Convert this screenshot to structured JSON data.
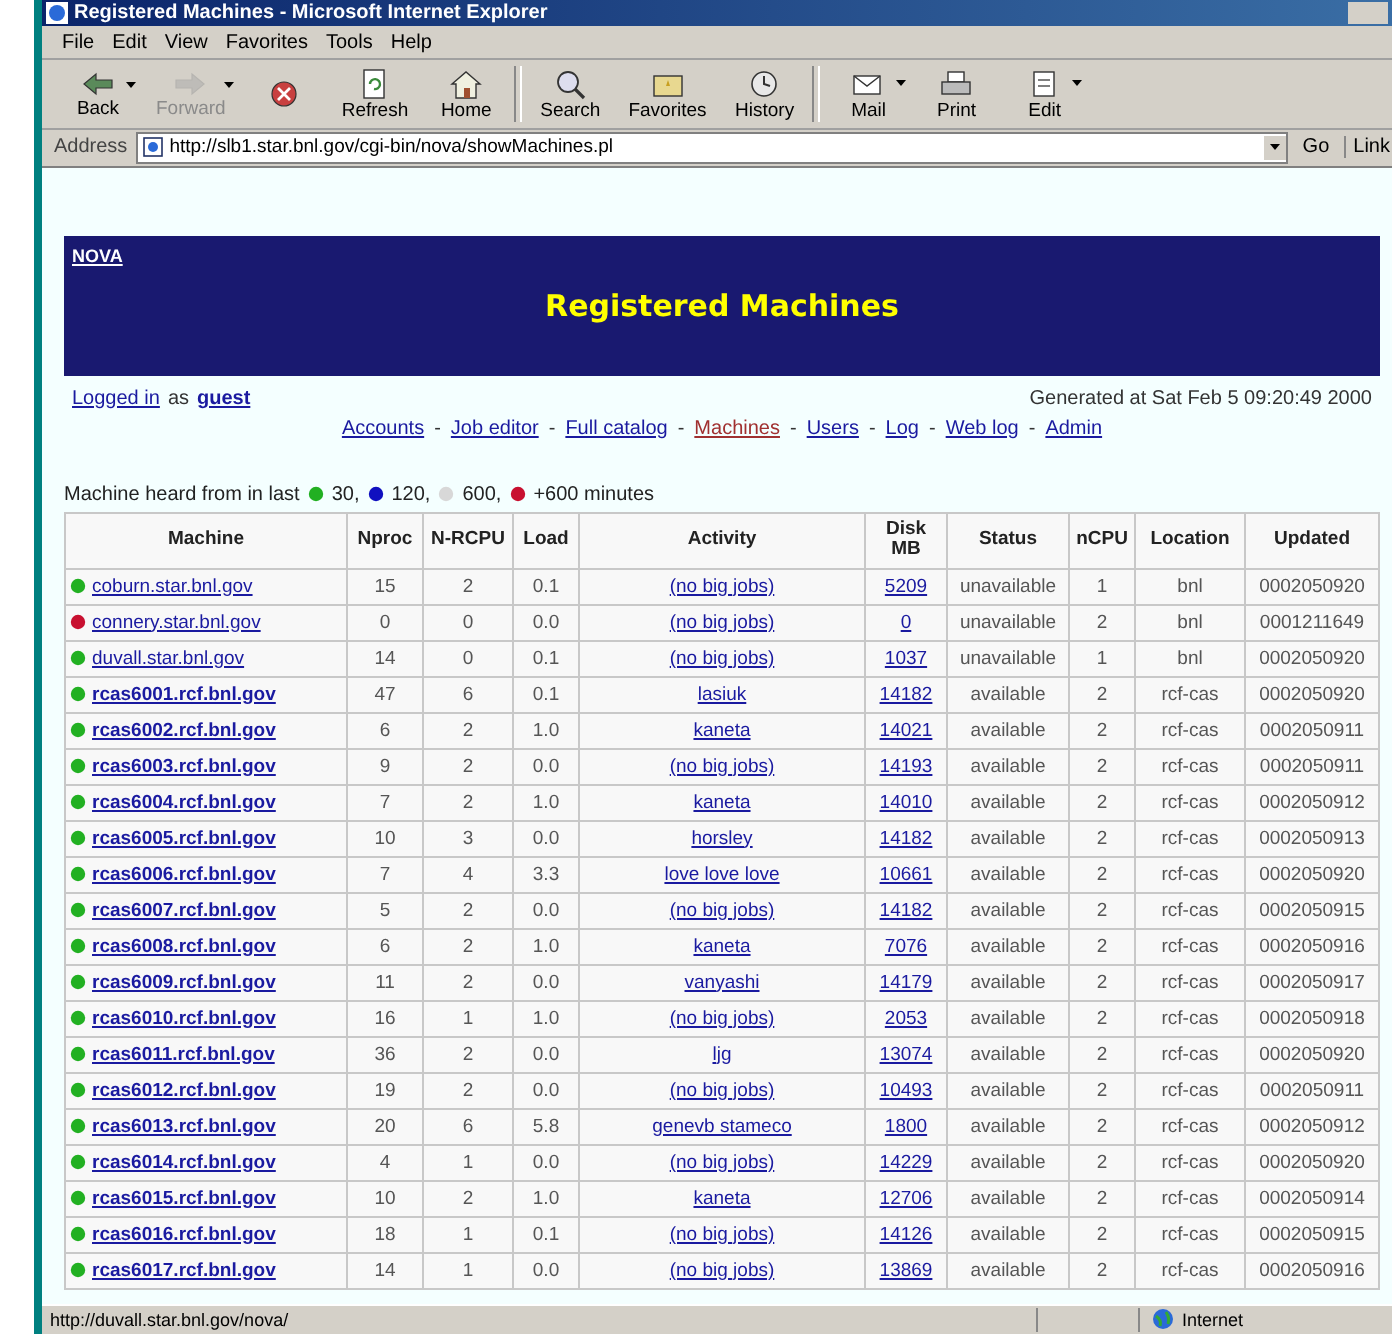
{
  "window": {
    "title": "Registered Machines - Microsoft Internet Explorer"
  },
  "menu": [
    "File",
    "Edit",
    "View",
    "Favorites",
    "Tools",
    "Help"
  ],
  "toolbar": {
    "buttons": [
      {
        "label": "Back",
        "kind": "back",
        "disabled": false,
        "has_menu": true,
        "divider_before": false
      },
      {
        "label": "Forward",
        "kind": "forward",
        "disabled": true,
        "has_menu": true,
        "divider_before": false
      },
      {
        "kind": "stop",
        "disabled": false,
        "has_menu": false,
        "divider_before": false
      },
      {
        "label": "Refresh",
        "kind": "refresh",
        "disabled": false,
        "has_menu": false,
        "divider_before": false
      },
      {
        "label": "Home",
        "kind": "home",
        "disabled": false,
        "has_menu": false,
        "divider_before": false
      },
      {
        "label": "Search",
        "kind": "search",
        "disabled": false,
        "has_menu": false,
        "divider_before": true
      },
      {
        "label": "Favorites",
        "kind": "favorites",
        "disabled": false,
        "has_menu": false,
        "divider_before": false
      },
      {
        "label": "History",
        "kind": "history",
        "disabled": false,
        "has_menu": false,
        "divider_before": false
      },
      {
        "label": "Mail",
        "kind": "mail",
        "disabled": false,
        "has_menu": true,
        "divider_before": true
      },
      {
        "label": "Print",
        "kind": "print",
        "disabled": false,
        "has_menu": false,
        "divider_before": false
      },
      {
        "label": "Edit",
        "kind": "edit",
        "disabled": false,
        "has_menu": true,
        "divider_before": false
      }
    ]
  },
  "address": {
    "label": "Address",
    "value": "http://slb1.star.bnl.gov/cgi-bin/nova/showMachines.pl",
    "go": "Go",
    "links": "Link"
  },
  "banner": {
    "home_link": "NOVA",
    "title": "Registered Machines"
  },
  "session": {
    "prefix": "Logged in",
    "middle": "as",
    "user": "guest",
    "generated": "Generated at Sat Feb 5 09:20:49 2000"
  },
  "nav": {
    "links": [
      {
        "label": "Accounts",
        "selected": false
      },
      {
        "label": "Job editor",
        "selected": false
      },
      {
        "label": "Full catalog",
        "selected": false
      },
      {
        "label": "Machines",
        "selected": true
      },
      {
        "label": "Users",
        "selected": false
      },
      {
        "label": "Log",
        "selected": false
      },
      {
        "label": "Web log",
        "selected": false
      },
      {
        "label": "Admin",
        "selected": false
      }
    ],
    "separator": "-"
  },
  "legend": {
    "text": "Machine heard from in last",
    "items": [
      {
        "label": "30,",
        "color": "#22b022"
      },
      {
        "label": "120,",
        "color": "#1010c0"
      },
      {
        "label": "600,",
        "color": "#d8d8d8"
      },
      {
        "label": "+600 minutes",
        "color": "#c81030"
      }
    ]
  },
  "table": {
    "columns": [
      "Machine",
      "Nproc",
      "N-RCPU",
      "Load",
      "Activity",
      "Disk MB",
      "Status",
      "nCPU",
      "Location",
      "Updated"
    ],
    "rows": [
      {
        "machine": "coburn.star.bnl.gov",
        "color": "#22b022",
        "emphasized": false,
        "nproc": "15",
        "nrcpu": "2",
        "load": "0.1",
        "activity": "(no big jobs)",
        "disk": "5209",
        "status": "unavailable",
        "ncpu": "1",
        "location": "bnl",
        "updated": "0002050920"
      },
      {
        "machine": "connery.star.bnl.gov",
        "color": "#c81030",
        "emphasized": false,
        "nproc": "0",
        "nrcpu": "0",
        "load": "0.0",
        "activity": "(no big jobs)",
        "disk": "0",
        "status": "unavailable",
        "ncpu": "2",
        "location": "bnl",
        "updated": "0001211649"
      },
      {
        "machine": "duvall.star.bnl.gov",
        "color": "#22b022",
        "emphasized": false,
        "nproc": "14",
        "nrcpu": "0",
        "load": "0.1",
        "activity": "(no big jobs)",
        "disk": "1037",
        "status": "unavailable",
        "ncpu": "1",
        "location": "bnl",
        "updated": "0002050920"
      },
      {
        "machine": "rcas6001.rcf.bnl.gov",
        "color": "#22b022",
        "emphasized": true,
        "nproc": "47",
        "nrcpu": "6",
        "load": "0.1",
        "activity": "lasiuk",
        "disk": "14182",
        "status": "available",
        "ncpu": "2",
        "location": "rcf-cas",
        "updated": "0002050920"
      },
      {
        "machine": "rcas6002.rcf.bnl.gov",
        "color": "#22b022",
        "emphasized": true,
        "nproc": "6",
        "nrcpu": "2",
        "load": "1.0",
        "activity": "kaneta",
        "disk": "14021",
        "status": "available",
        "ncpu": "2",
        "location": "rcf-cas",
        "updated": "0002050911"
      },
      {
        "machine": "rcas6003.rcf.bnl.gov",
        "color": "#22b022",
        "emphasized": true,
        "nproc": "9",
        "nrcpu": "2",
        "load": "0.0",
        "activity": "(no big jobs)",
        "disk": "14193",
        "status": "available",
        "ncpu": "2",
        "location": "rcf-cas",
        "updated": "0002050911"
      },
      {
        "machine": "rcas6004.rcf.bnl.gov",
        "color": "#22b022",
        "emphasized": true,
        "nproc": "7",
        "nrcpu": "2",
        "load": "1.0",
        "activity": "kaneta",
        "disk": "14010",
        "status": "available",
        "ncpu": "2",
        "location": "rcf-cas",
        "updated": "0002050912"
      },
      {
        "machine": "rcas6005.rcf.bnl.gov",
        "color": "#22b022",
        "emphasized": true,
        "nproc": "10",
        "nrcpu": "3",
        "load": "0.0",
        "activity": "horsley",
        "disk": "14182",
        "status": "available",
        "ncpu": "2",
        "location": "rcf-cas",
        "updated": "0002050913"
      },
      {
        "machine": "rcas6006.rcf.bnl.gov",
        "color": "#22b022",
        "emphasized": true,
        "nproc": "7",
        "nrcpu": "4",
        "load": "3.3",
        "activity": "love love love",
        "disk": "10661",
        "status": "available",
        "ncpu": "2",
        "location": "rcf-cas",
        "updated": "0002050920"
      },
      {
        "machine": "rcas6007.rcf.bnl.gov",
        "color": "#22b022",
        "emphasized": true,
        "nproc": "5",
        "nrcpu": "2",
        "load": "0.0",
        "activity": "(no big jobs)",
        "disk": "14182",
        "status": "available",
        "ncpu": "2",
        "location": "rcf-cas",
        "updated": "0002050915"
      },
      {
        "machine": "rcas6008.rcf.bnl.gov",
        "color": "#22b022",
        "emphasized": true,
        "nproc": "6",
        "nrcpu": "2",
        "load": "1.0",
        "activity": "kaneta",
        "disk": "7076",
        "status": "available",
        "ncpu": "2",
        "location": "rcf-cas",
        "updated": "0002050916"
      },
      {
        "machine": "rcas6009.rcf.bnl.gov",
        "color": "#22b022",
        "emphasized": true,
        "nproc": "11",
        "nrcpu": "2",
        "load": "0.0",
        "activity": "vanyashi",
        "disk": "14179",
        "status": "available",
        "ncpu": "2",
        "location": "rcf-cas",
        "updated": "0002050917"
      },
      {
        "machine": "rcas6010.rcf.bnl.gov",
        "color": "#22b022",
        "emphasized": true,
        "nproc": "16",
        "nrcpu": "1",
        "load": "1.0",
        "activity": "(no big jobs)",
        "disk": "2053",
        "status": "available",
        "ncpu": "2",
        "location": "rcf-cas",
        "updated": "0002050918"
      },
      {
        "machine": "rcas6011.rcf.bnl.gov",
        "color": "#22b022",
        "emphasized": true,
        "nproc": "36",
        "nrcpu": "2",
        "load": "0.0",
        "activity": "ljg",
        "disk": "13074",
        "status": "available",
        "ncpu": "2",
        "location": "rcf-cas",
        "updated": "0002050920"
      },
      {
        "machine": "rcas6012.rcf.bnl.gov",
        "color": "#22b022",
        "emphasized": true,
        "nproc": "19",
        "nrcpu": "2",
        "load": "0.0",
        "activity": "(no big jobs)",
        "disk": "10493",
        "status": "available",
        "ncpu": "2",
        "location": "rcf-cas",
        "updated": "0002050911"
      },
      {
        "machine": "rcas6013.rcf.bnl.gov",
        "color": "#22b022",
        "emphasized": true,
        "nproc": "20",
        "nrcpu": "6",
        "load": "5.8",
        "activity": "genevb stameco",
        "disk": "1800",
        "status": "available",
        "ncpu": "2",
        "location": "rcf-cas",
        "updated": "0002050912"
      },
      {
        "machine": "rcas6014.rcf.bnl.gov",
        "color": "#22b022",
        "emphasized": true,
        "nproc": "4",
        "nrcpu": "1",
        "load": "0.0",
        "activity": "(no big jobs)",
        "disk": "14229",
        "status": "available",
        "ncpu": "2",
        "location": "rcf-cas",
        "updated": "0002050920"
      },
      {
        "machine": "rcas6015.rcf.bnl.gov",
        "color": "#22b022",
        "emphasized": true,
        "nproc": "10",
        "nrcpu": "2",
        "load": "1.0",
        "activity": "kaneta",
        "disk": "12706",
        "status": "available",
        "ncpu": "2",
        "location": "rcf-cas",
        "updated": "0002050914"
      },
      {
        "machine": "rcas6016.rcf.bnl.gov",
        "color": "#22b022",
        "emphasized": true,
        "nproc": "18",
        "nrcpu": "1",
        "load": "0.1",
        "activity": "(no big jobs)",
        "disk": "14126",
        "status": "available",
        "ncpu": "2",
        "location": "rcf-cas",
        "updated": "0002050915"
      },
      {
        "machine": "rcas6017.rcf.bnl.gov",
        "color": "#22b022",
        "emphasized": true,
        "nproc": "14",
        "nrcpu": "1",
        "load": "0.0",
        "activity": "(no big jobs)",
        "disk": "13869",
        "status": "available",
        "ncpu": "2",
        "location": "rcf-cas",
        "updated": "0002050916"
      }
    ]
  },
  "status_bar": {
    "text": "http://duvall.star.bnl.gov/nova/",
    "zone": "Internet"
  }
}
